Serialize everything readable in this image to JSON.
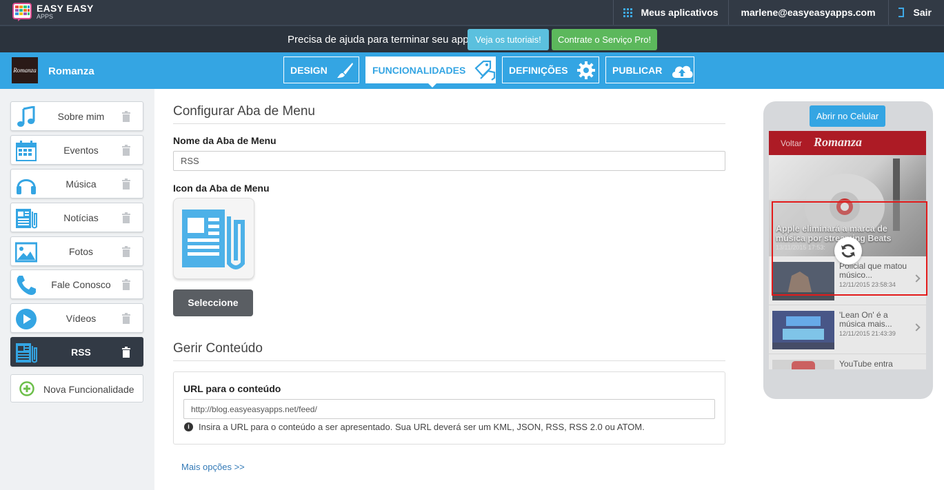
{
  "topbar": {
    "brand": "EASY EASY",
    "brand_sub": "APPS",
    "my_apps": "Meus aplicativos",
    "user_email": "marlene@easyeasyapps.com",
    "logout": "Sair"
  },
  "helpbar": {
    "text": "Precisa de ajuda para terminar seu app?",
    "tutorials_button": "Veja os tutoriais!",
    "pro_button": "Contrate o Serviço Pro!"
  },
  "appbar": {
    "app_thumb_text": "Romanza",
    "app_name": "Romanza",
    "tabs": [
      {
        "label": "DESIGN",
        "icon": "brush-icon"
      },
      {
        "label": "FUNCIONALIDADES",
        "icon": "tags-icon",
        "active": true
      },
      {
        "label": "DEFINIÇÕES",
        "icon": "gear-icon"
      },
      {
        "label": "PUBLICAR",
        "icon": "cloud-upload-icon"
      }
    ]
  },
  "sidebar": {
    "items": [
      {
        "label": "Sobre mim",
        "icon": "music-note-icon"
      },
      {
        "label": "Eventos",
        "icon": "calendar-icon"
      },
      {
        "label": "Música",
        "icon": "headphones-icon"
      },
      {
        "label": "Notícias",
        "icon": "newspaper-icon"
      },
      {
        "label": "Fotos",
        "icon": "photo-icon"
      },
      {
        "label": "Fale Conosco",
        "icon": "phone-icon"
      },
      {
        "label": "Vídeos",
        "icon": "play-icon"
      },
      {
        "label": "RSS",
        "icon": "newspaper-icon",
        "active": true
      }
    ],
    "add_label": "Nova Funcionalidade"
  },
  "main": {
    "config_title": "Configurar Aba de Menu",
    "name_label": "Nome da Aba de Menu",
    "name_value": "RSS",
    "icon_label": "Icon da Aba de Menu",
    "select_button": "Seleccione",
    "content_title": "Gerir Conteúdo",
    "url_label": "URL para o conteúdo",
    "url_value": "http://blog.easyeasyapps.net/feed/",
    "url_hint": "Insira a URL para o conteúdo a ser apresentado. Sua URL deverá ser um KML, JSON, RSS, RSS 2.0 ou ATOM.",
    "more_options": "Mais opções >>"
  },
  "preview": {
    "open_button": "Abrir no Celular",
    "back": "Voltar",
    "title": "Romanza",
    "hero_title": "Apple eliminará a marca de música por streaming Beats",
    "hero_date": "13/11/2015 17:53:",
    "rows": [
      {
        "title": "Policial que matou músico...",
        "date": "12/11/2015 23:58:34"
      },
      {
        "title": "'Lean On' é a música mais...",
        "date": "12/11/2015 21:43:39"
      },
      {
        "title": "YouTube entra",
        "date": ""
      }
    ]
  },
  "colors": {
    "topbar": "#323a45",
    "accent": "#34a5e3",
    "tutorial_button": "#5bc0de",
    "pro_button": "#5cb85c",
    "preview_header": "#ad1b25",
    "highlight": "#e31b1b"
  }
}
